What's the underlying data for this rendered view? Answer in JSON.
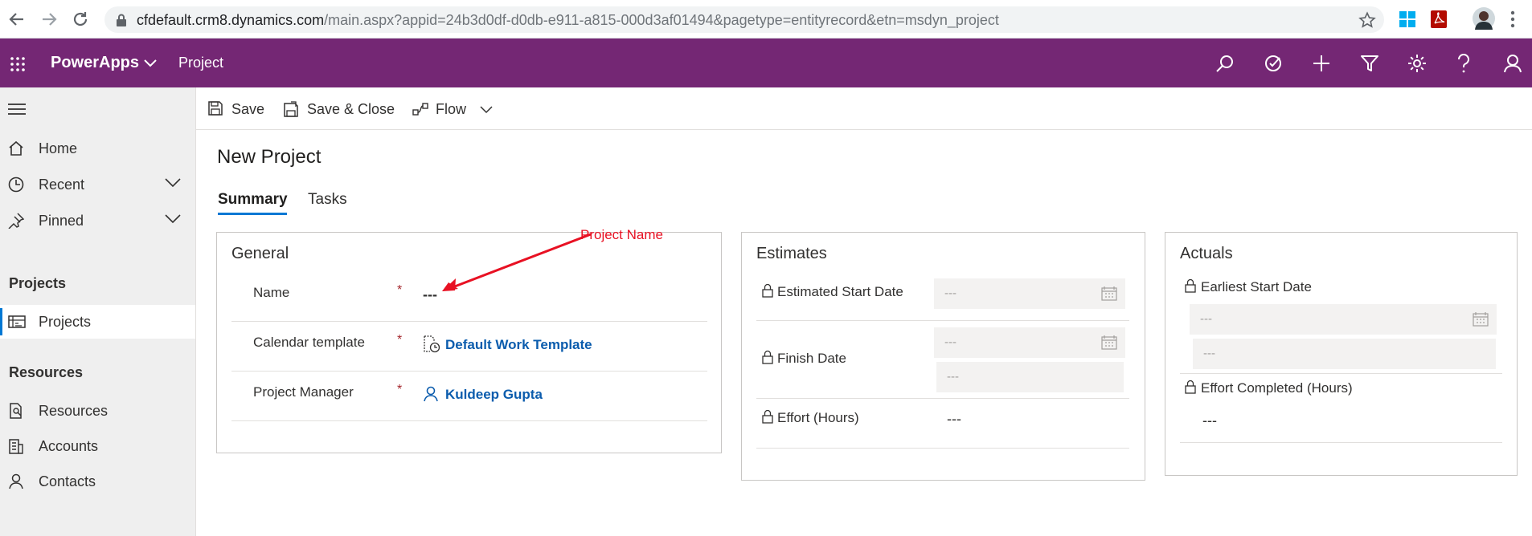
{
  "browser": {
    "url_host": "cfdefault.crm8.dynamics.com",
    "url_path": "/main.aspx?appid=24b3d0df-d0db-e911-a815-000d3af01494&pagetype=entityrecord&etn=msdyn_project"
  },
  "appbar": {
    "app_name": "PowerApps",
    "entity": "Project"
  },
  "sidebar": {
    "items": [
      {
        "label": "Home",
        "icon": "home-icon"
      },
      {
        "label": "Recent",
        "icon": "clock-icon"
      },
      {
        "label": "Pinned",
        "icon": "pin-icon"
      }
    ],
    "projects_section": "Projects",
    "projects_item": "Projects",
    "resources_section": "Resources",
    "resources_items": [
      {
        "label": "Resources",
        "icon": "resources-icon"
      },
      {
        "label": "Accounts",
        "icon": "accounts-icon"
      },
      {
        "label": "Contacts",
        "icon": "person-icon"
      }
    ]
  },
  "commands": {
    "save": "Save",
    "save_close": "Save & Close",
    "flow": "Flow"
  },
  "page": {
    "title": "New Project",
    "tabs": [
      "Summary",
      "Tasks"
    ],
    "selected_tab": "Summary"
  },
  "general": {
    "title": "General",
    "name_label": "Name",
    "name_value": "---",
    "calendar_label": "Calendar template",
    "calendar_value": "Default Work Template",
    "manager_label": "Project Manager",
    "manager_value": "Kuldeep Gupta",
    "required_mark": "*"
  },
  "estimates": {
    "title": "Estimates",
    "start_label": "Estimated Start Date",
    "start_placeholder": "---",
    "finish_label": "Finish Date",
    "finish_date_placeholder": "---",
    "finish_time_placeholder": "---",
    "effort_label": "Effort (Hours)",
    "effort_value": "---"
  },
  "actuals": {
    "title": "Actuals",
    "earliest_label": "Earliest Start Date",
    "earliest_date_placeholder": "---",
    "earliest_time_placeholder": "---",
    "effort_completed_label": "Effort Completed (Hours)",
    "effort_completed_value": "---"
  },
  "annotation": {
    "text": "Project Name",
    "color": "#e81123"
  },
  "colors": {
    "header": "#742774",
    "accent": "#0078d4",
    "link": "#0b5cad",
    "required": "#a4262c"
  }
}
